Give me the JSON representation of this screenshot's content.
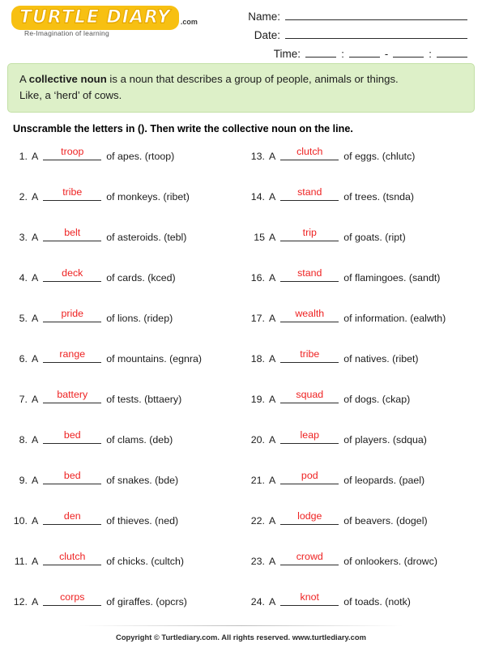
{
  "brand": {
    "logo_text": "TURTLE DIARY",
    "logo_suffix": ".com",
    "tagline": "Re-Imagination of learning",
    "logo_color": "#f7c012"
  },
  "header_fields": {
    "name_label": "Name:",
    "date_label": "Date:",
    "time_label": "Time:",
    "time_sep_1": ":",
    "time_sep_2": "-",
    "time_sep_3": ":"
  },
  "definition": {
    "lead": "A",
    "term": "collective noun",
    "body": "is a noun that describes a group of people, animals or things.",
    "example": "Like, a ‘herd’ of cows.",
    "background": "#ddf0c8",
    "border": "#c3e0a6"
  },
  "instruction": "Unscramble the letters in (). Then write the collective noun on the line.",
  "answer_color": "#ee2222",
  "questions": {
    "left": [
      {
        "num": "1.",
        "a": "A",
        "answer": "troop",
        "tail": "of apes. (rtoop)"
      },
      {
        "num": "2.",
        "a": "A",
        "answer": "tribe",
        "tail": "of monkeys. (ribet)"
      },
      {
        "num": "3.",
        "a": "A",
        "answer": "belt",
        "tail": "of asteroids. (tebl)"
      },
      {
        "num": "4.",
        "a": "A",
        "answer": "deck",
        "tail": "of cards. (kced)"
      },
      {
        "num": "5.",
        "a": "A",
        "answer": "pride",
        "tail": "of lions. (ridep)"
      },
      {
        "num": "6.",
        "a": "A",
        "answer": "range",
        "tail": "of mountains. (egnra)"
      },
      {
        "num": "7.",
        "a": "A",
        "answer": "battery",
        "tail": "of tests. (bttaery)"
      },
      {
        "num": "8.",
        "a": "A",
        "answer": "bed",
        "tail": "of clams. (deb)"
      },
      {
        "num": "9.",
        "a": "A",
        "answer": "bed",
        "tail": "of snakes. (bde)"
      },
      {
        "num": "10.",
        "a": "A",
        "answer": "den",
        "tail": "of thieves. (ned)"
      },
      {
        "num": "11.",
        "a": "A",
        "answer": "clutch",
        "tail": "of chicks. (cultch)"
      },
      {
        "num": "12.",
        "a": "A",
        "answer": "corps",
        "tail": "of giraffes. (opcrs)"
      }
    ],
    "right": [
      {
        "num": "13.",
        "a": "A",
        "answer": "clutch",
        "tail": "of eggs. (chlutc)"
      },
      {
        "num": "14.",
        "a": "A",
        "answer": "stand",
        "tail": "of trees. (tsnda)"
      },
      {
        "num": "15",
        "a": "A",
        "answer": "trip",
        "tail": "of goats. (ript)"
      },
      {
        "num": "16.",
        "a": "A",
        "answer": "stand",
        "tail": "of flamingoes. (sandt)"
      },
      {
        "num": "17.",
        "a": "A",
        "answer": "wealth",
        "tail": "of information. (ealwth)"
      },
      {
        "num": "18.",
        "a": "A",
        "answer": "tribe",
        "tail": "of natives. (ribet)"
      },
      {
        "num": "19.",
        "a": "A",
        "answer": "squad",
        "tail": "of dogs. (ckap)"
      },
      {
        "num": "20.",
        "a": "A",
        "answer": "leap",
        "tail": "of players. (sdqua)"
      },
      {
        "num": "21.",
        "a": "A",
        "answer": "pod",
        "tail": "of leopards. (pael)"
      },
      {
        "num": "22.",
        "a": "A",
        "answer": "lodge",
        "tail": "of beavers. (dogel)"
      },
      {
        "num": "23.",
        "a": "A",
        "answer": "crowd",
        "tail": "of onlookers. (drowc)"
      },
      {
        "num": "24.",
        "a": "A",
        "answer": "knot",
        "tail": "of toads. (notk)"
      }
    ]
  },
  "footer": {
    "copyright": "Copyright © Turtlediary.com. All rights reserved. www.turtlediary.com"
  }
}
